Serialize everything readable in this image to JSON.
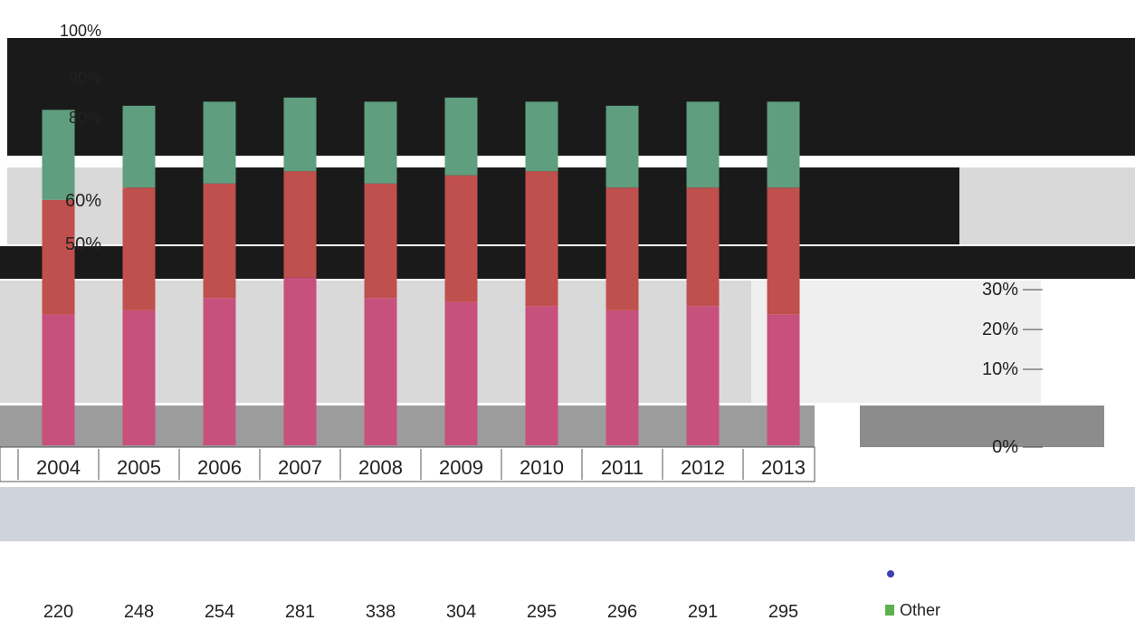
{
  "chart_data": {
    "type": "bar",
    "stacked": true,
    "y_axis": {
      "ticks_top": [
        "100%",
        "90%",
        "80%"
      ],
      "ticks_mid": [
        "60%",
        "50%"
      ],
      "ticks_low": [
        "30%",
        "20%",
        "10%",
        "0%"
      ]
    },
    "categories": [
      "2004",
      "2005",
      "2006",
      "2007",
      "2008",
      "2009",
      "2010",
      "2011",
      "2012",
      "2013"
    ],
    "series": [
      {
        "name": "",
        "color": "#c8507c",
        "values": [
          0.32,
          0.33,
          0.36,
          0.41,
          0.36,
          0.35,
          0.34,
          0.33,
          0.34,
          0.32
        ]
      },
      {
        "name": "",
        "color": "#c0504d",
        "values": [
          0.28,
          0.3,
          0.28,
          0.26,
          0.28,
          0.31,
          0.33,
          0.3,
          0.29,
          0.31
        ]
      },
      {
        "name": "",
        "color": "#5f9e7e",
        "values": [
          0.22,
          0.2,
          0.2,
          0.18,
          0.2,
          0.19,
          0.17,
          0.2,
          0.21,
          0.21
        ]
      }
    ],
    "table_rows": [
      [
        "220",
        "248",
        "254",
        "281",
        "338",
        "304",
        "295",
        "296",
        "291",
        "295"
      ]
    ],
    "legend": [
      "Other"
    ],
    "ylim": [
      0,
      1
    ]
  },
  "legend_labels": {
    "other": "Other"
  },
  "colors": {
    "pink": "#c8507c",
    "red": "#c0504d",
    "green": "#5f9e7e",
    "brown": "#a97a5a",
    "dark": "#1a1a1a",
    "gray": "#8c8c8c",
    "lightgray": "#d9d9d9"
  }
}
